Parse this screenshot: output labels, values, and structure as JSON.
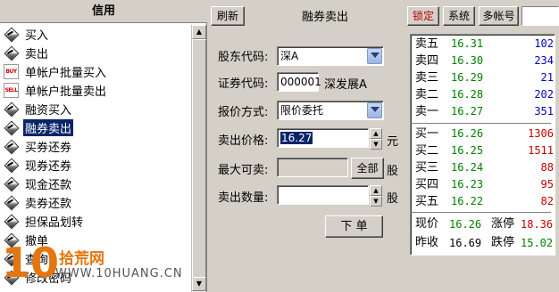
{
  "left_panel": {
    "header": "信用",
    "items": [
      {
        "label": "买入",
        "icon": "diamond-icon"
      },
      {
        "label": "卖出",
        "icon": "diamond-icon"
      },
      {
        "label": "单帐户批量买入",
        "icon": "buy-icon",
        "icon_text": "BUY"
      },
      {
        "label": "单帐户批量卖出",
        "icon": "sell-icon",
        "icon_text": "SELL"
      },
      {
        "label": "融资买入",
        "icon": "diamond-icon"
      },
      {
        "label": "融券卖出",
        "icon": "diamond-icon",
        "selected": true
      },
      {
        "label": "买券还券",
        "icon": "diamond-icon"
      },
      {
        "label": "现券还券",
        "icon": "diamond-icon"
      },
      {
        "label": "现金还款",
        "icon": "diamond-icon"
      },
      {
        "label": "卖券还款",
        "icon": "diamond-icon"
      },
      {
        "label": "担保品划转",
        "icon": "diamond-icon"
      },
      {
        "label": "撤单",
        "icon": "diamond-icon"
      },
      {
        "label": "查询",
        "icon": "diamond-icon"
      },
      {
        "label": "修改密码",
        "icon": "diamond-icon"
      }
    ]
  },
  "toolbar": {
    "refresh": "刷新",
    "title": "融券卖出",
    "lock": "锁定",
    "system": "系统",
    "multi_account": "多帐号",
    "search_value": ""
  },
  "form": {
    "shareholder_label": "股东代码:",
    "shareholder_value": "深A",
    "security_label": "证券代码:",
    "security_code": "000001",
    "security_name": "深发展A",
    "quote_method_label": "报价方式:",
    "quote_method_value": "限价委托",
    "price_label": "卖出价格:",
    "price_value": "16.27",
    "price_unit": "元",
    "max_sell_label": "最大可卖:",
    "max_sell_value": "",
    "all_button": "全部",
    "max_sell_unit": "股",
    "quantity_label": "卖出数量:",
    "quantity_value": "",
    "quantity_unit": "股",
    "submit": "下 单"
  },
  "order_book": {
    "asks": [
      {
        "label": "卖五",
        "price": "16.31",
        "volume": "102"
      },
      {
        "label": "卖四",
        "price": "16.30",
        "volume": "234"
      },
      {
        "label": "卖三",
        "price": "16.29",
        "volume": "21"
      },
      {
        "label": "卖二",
        "price": "16.28",
        "volume": "202"
      },
      {
        "label": "卖一",
        "price": "16.27",
        "volume": "351"
      }
    ],
    "bids": [
      {
        "label": "买一",
        "price": "16.26",
        "volume": "1306"
      },
      {
        "label": "买二",
        "price": "16.25",
        "volume": "1511"
      },
      {
        "label": "买三",
        "price": "16.24",
        "volume": "88"
      },
      {
        "label": "买四",
        "price": "16.23",
        "volume": "95"
      },
      {
        "label": "买五",
        "price": "16.22",
        "volume": "82"
      }
    ],
    "volume_color_ask": "#0000c0",
    "volume_color_bid": "#c00000",
    "price_color": "#008000"
  },
  "summary": {
    "current_label": "现价",
    "current_value": "16.26",
    "limit_up_label": "涨停",
    "limit_up_value": "18.36",
    "prev_close_label": "昨收",
    "prev_close_value": "16.69",
    "limit_down_label": "跌停",
    "limit_down_value": "15.02"
  },
  "watermark": {
    "number": "10",
    "brand": "拾荒网",
    "url": "WWW.10HUANG.CN"
  }
}
